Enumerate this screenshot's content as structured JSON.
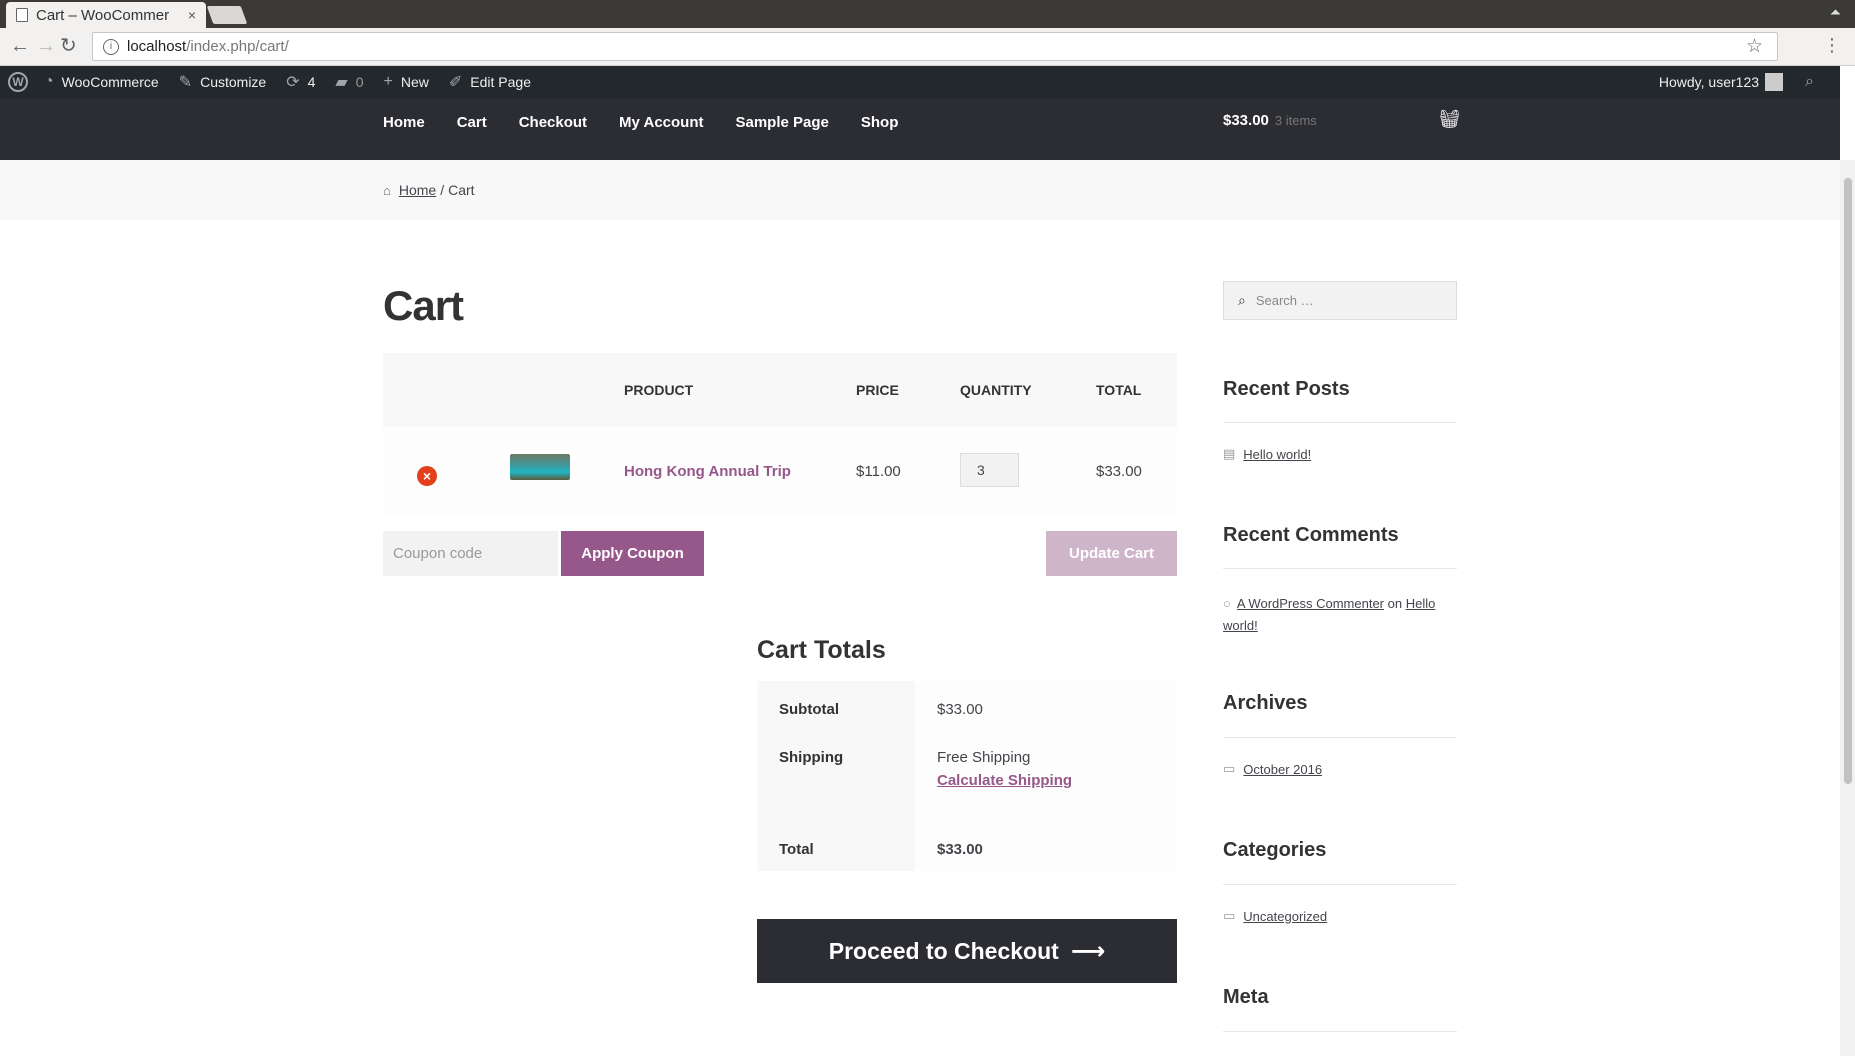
{
  "browser": {
    "tab_title": "Cart – WooCommer",
    "tab_close": "×",
    "url_host": "localhost",
    "url_path": "/index.php/cart/"
  },
  "adminbar": {
    "site": "WooCommerce",
    "customize": "Customize",
    "updates": "4",
    "comments": "0",
    "new": "New",
    "edit": "Edit Page",
    "howdy": "Howdy, user123"
  },
  "nav": {
    "items": [
      "Home",
      "Cart",
      "Checkout",
      "My Account",
      "Sample Page",
      "Shop"
    ],
    "cart_total": "$33.00",
    "cart_count": "3 items"
  },
  "breadcrumb": {
    "home": "Home",
    "sep": "/",
    "current": "Cart"
  },
  "page": {
    "title": "Cart"
  },
  "cart": {
    "headers": [
      "PRODUCT",
      "PRICE",
      "QUANTITY",
      "TOTAL"
    ],
    "item": {
      "name": "Hong Kong Annual Trip",
      "price": "$11.00",
      "quantity": "3",
      "total": "$33.00"
    },
    "coupon_placeholder": "Coupon code",
    "apply_label": "Apply Coupon",
    "update_label": "Update Cart"
  },
  "totals": {
    "title": "Cart Totals",
    "subtotal_label": "Subtotal",
    "subtotal": "$33.00",
    "shipping_label": "Shipping",
    "shipping": "Free Shipping",
    "calc_shipping": "Calculate Shipping",
    "total_label": "Total",
    "total": "$33.00",
    "checkout_label": "Proceed to Checkout",
    "arrow": "⟶"
  },
  "sidebar": {
    "search_placeholder": "Search …",
    "recent_posts_title": "Recent Posts",
    "recent_post": "Hello world!",
    "recent_comments_title": "Recent Comments",
    "comment_author": "A WordPress Commenter",
    "comment_on": "on",
    "comment_post": "Hello world!",
    "archives_title": "Archives",
    "archive_item": "October 2016",
    "categories_title": "Categories",
    "category_item": "Uncategorized",
    "meta_title": "Meta"
  },
  "colors": {
    "accent": "#96588a",
    "header_bg": "#2c2d33",
    "remove": "#e2401c"
  }
}
